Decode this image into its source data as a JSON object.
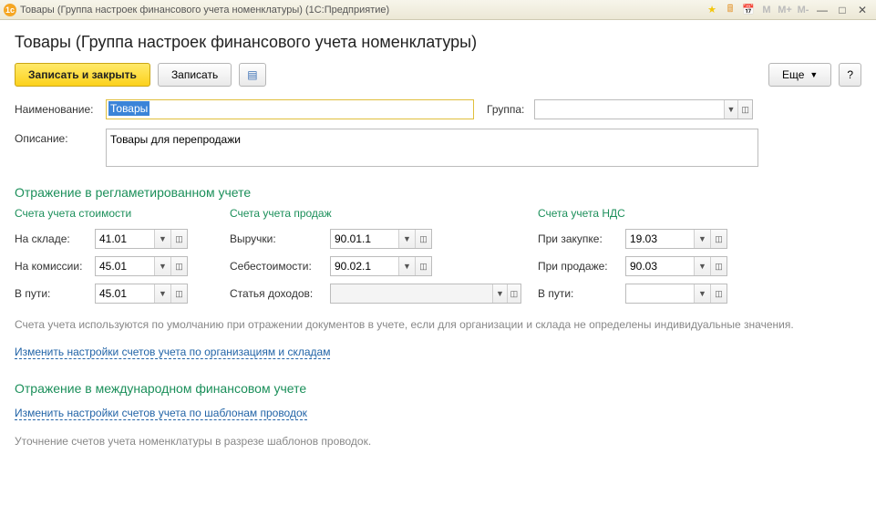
{
  "titlebar": {
    "title": "Товары (Группа настроек финансового учета номенклатуры)  (1С:Предприятие)",
    "m_labels": [
      "M",
      "M+",
      "M-"
    ]
  },
  "header": {
    "title": "Товары (Группа настроек финансового учета номенклатуры)"
  },
  "toolbar": {
    "save_close": "Записать и закрыть",
    "save": "Записать",
    "more": "Еще",
    "help": "?"
  },
  "fields": {
    "name_label": "Наименование:",
    "name_value": "Товары",
    "group_label": "Группа:",
    "group_value": "",
    "desc_label": "Описание:",
    "desc_value": "Товары для перепродажи"
  },
  "section1": {
    "title": "Отражение в регламетированном учете",
    "col1": {
      "head": "Счета учета стоимости",
      "rows": [
        {
          "label": "На складе:",
          "value": "41.01"
        },
        {
          "label": "На комиссии:",
          "value": "45.01"
        },
        {
          "label": "В пути:",
          "value": "45.01"
        }
      ]
    },
    "col2": {
      "head": "Счета учета продаж",
      "rows": [
        {
          "label": "Выручки:",
          "value": "90.01.1"
        },
        {
          "label": "Себестоимости:",
          "value": "90.02.1"
        },
        {
          "label": "Статья доходов:",
          "value": "",
          "disabled": true
        }
      ]
    },
    "col3": {
      "head": "Счета учета НДС",
      "rows": [
        {
          "label": "При закупке:",
          "value": "19.03"
        },
        {
          "label": "При продаже:",
          "value": "90.03"
        },
        {
          "label": "В пути:",
          "value": ""
        }
      ]
    },
    "note": "Счета учета используются по умолчанию при отражении документов в учете, если для организации и склада не определены индивидуальные значения.",
    "link": "Изменить настройки счетов учета по организациям и складам"
  },
  "section2": {
    "title": "Отражение в международном финансовом учете",
    "link": "Изменить настройки счетов учета по шаблонам проводок",
    "note": "Уточнение счетов учета номенклатуры в разрезе шаблонов проводок."
  }
}
